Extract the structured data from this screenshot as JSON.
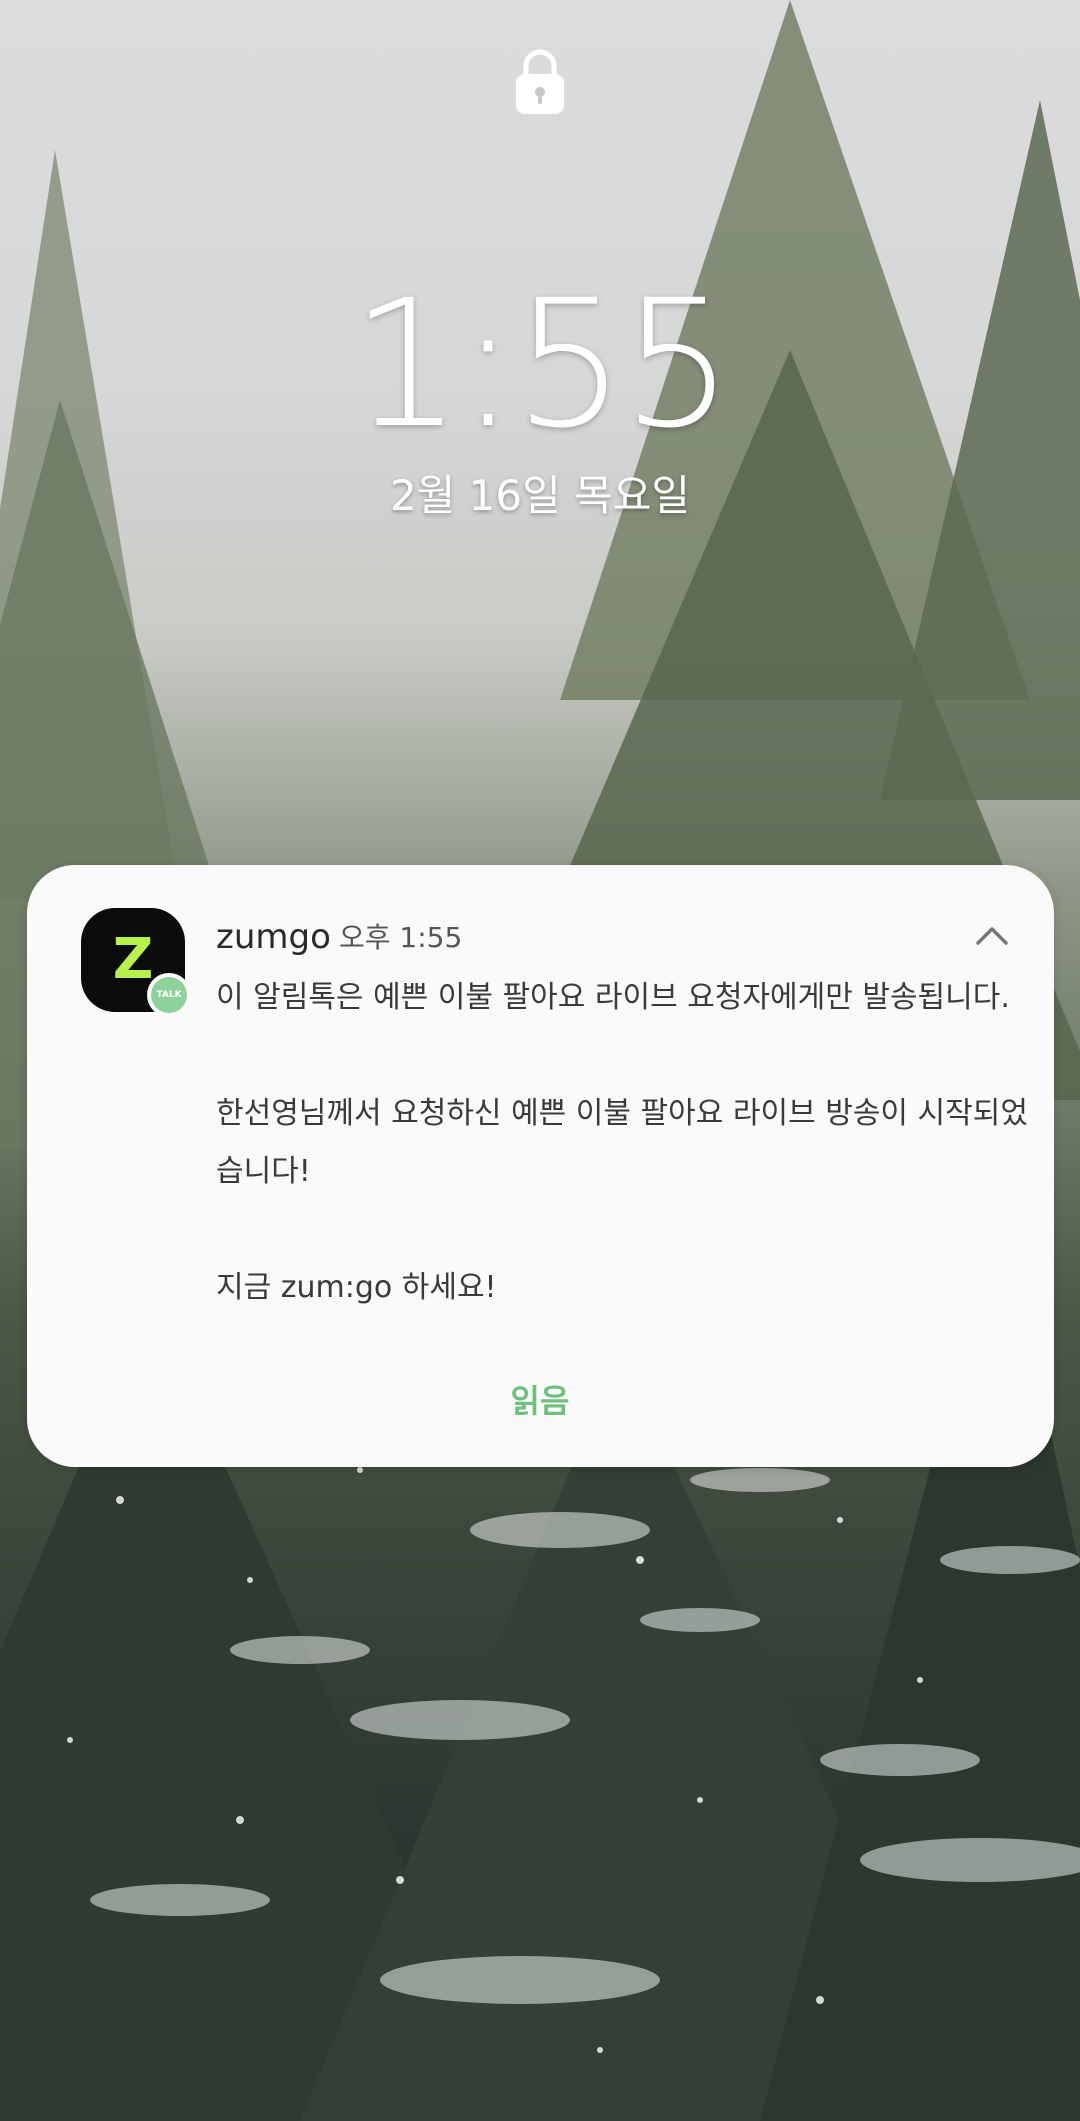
{
  "lockscreen": {
    "lock_icon": "lock-icon",
    "time": "1:55",
    "date": "2월 16일 목요일"
  },
  "notification": {
    "app_icon": "zumgo-app-icon",
    "app_icon_letter": "Z",
    "badge": "talk-badge-icon",
    "badge_text": "TALK",
    "app_name": "zumgo",
    "time": "오후 1:55",
    "collapse_icon": "chevron-up-icon",
    "message": "이 알림톡은 예쁜 이불 팔아요 라이브 요청자에게만 발송됩니다.\n\n한선영님께서 요청하신 예쁜 이불 팔아요 라이브 방송이 시작되었습니다!\n\n지금 zum:go 하세요!",
    "action_label": "읽음"
  },
  "colors": {
    "card_background": "#fafafa",
    "action_text": "#6fbf7d",
    "app_icon_background": "#0b0b0b",
    "app_icon_letter": "#b6f24a"
  }
}
